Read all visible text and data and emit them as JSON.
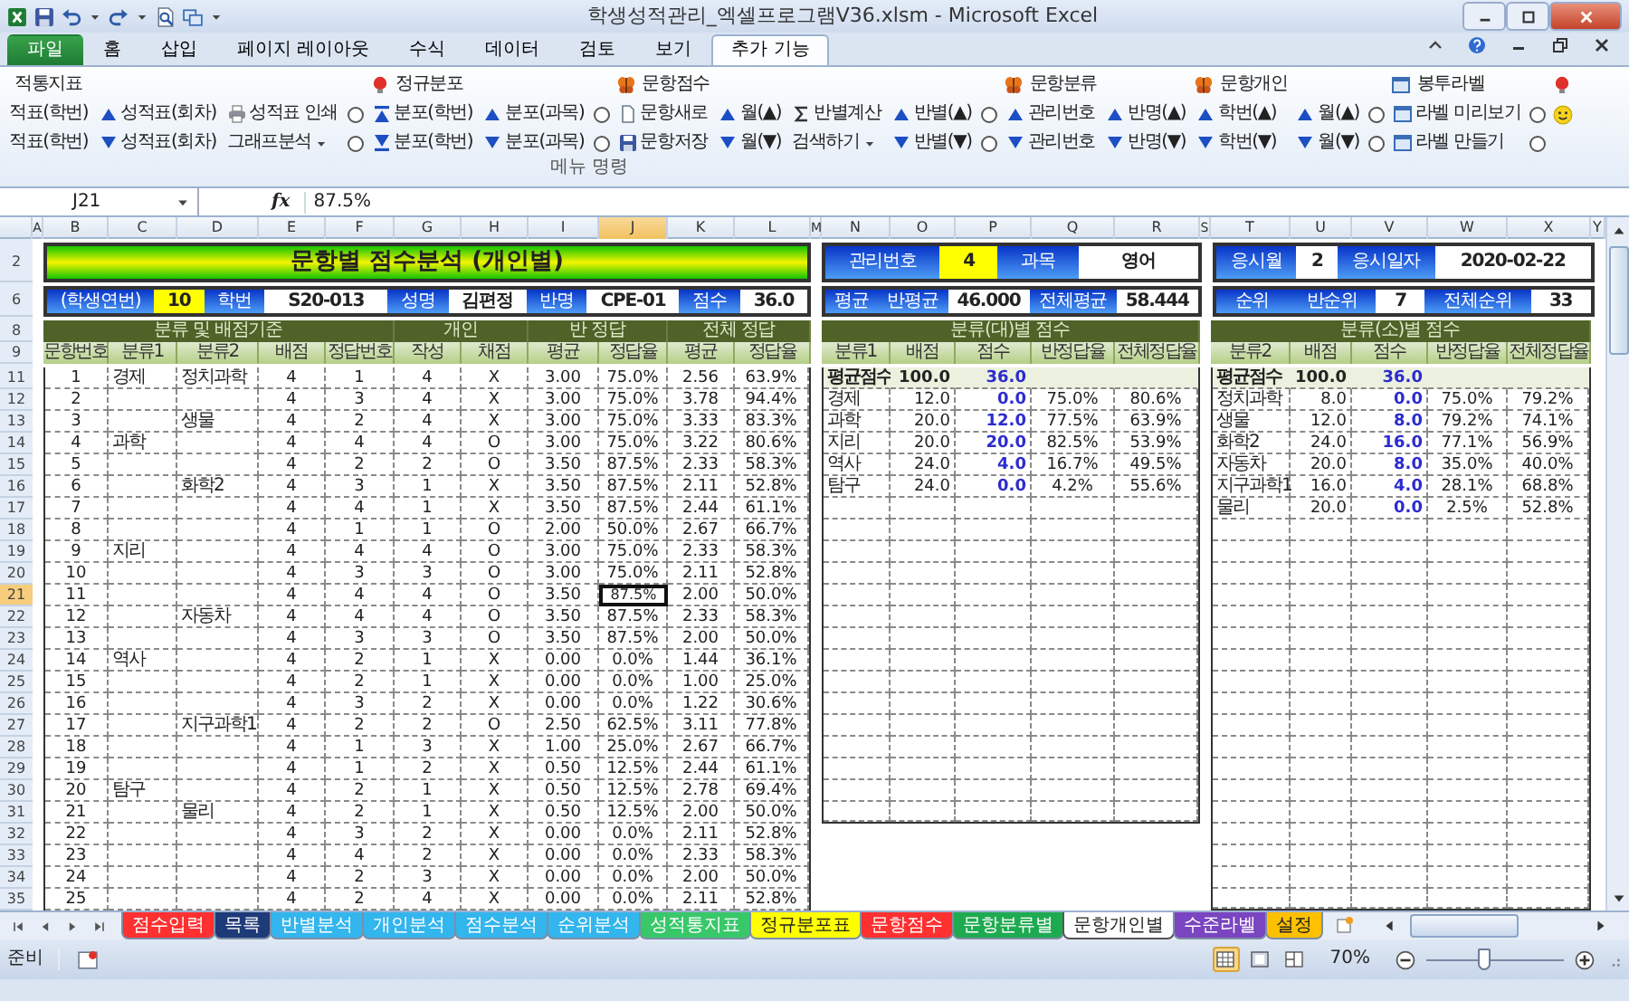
{
  "window": {
    "title": "학생성적관리_엑셀프로그램V36.xlsm  -  Microsoft Excel"
  },
  "ribbon_tabs": [
    {
      "label": "파일",
      "kind": "file",
      "selected": false
    },
    {
      "label": "홈",
      "kind": "tab",
      "selected": false
    },
    {
      "label": "삽입",
      "kind": "tab",
      "selected": false
    },
    {
      "label": "페이지 레이아웃",
      "kind": "tab",
      "selected": false
    },
    {
      "label": "수식",
      "kind": "tab",
      "selected": false
    },
    {
      "label": "데이터",
      "kind": "tab",
      "selected": false
    },
    {
      "label": "검토",
      "kind": "tab",
      "selected": false
    },
    {
      "label": "보기",
      "kind": "tab",
      "selected": false
    },
    {
      "label": "추가 기능",
      "kind": "tab",
      "selected": true
    }
  ],
  "ribbon": {
    "columns": [
      {
        "heading": {
          "kind": "heading",
          "label": "적통지표"
        },
        "items": [
          {
            "kind": "text",
            "label": "적표(학번)"
          },
          {
            "kind": "text",
            "label": "적표(학번)"
          }
        ]
      },
      {
        "items": [
          {
            "kind": "up",
            "label": "성적표(회차)"
          },
          {
            "kind": "down",
            "label": "성적표(회차)"
          }
        ]
      },
      {
        "items": [
          {
            "kind": "print",
            "label": "성적표 인쇄"
          },
          {
            "kind": "menu",
            "label": "그래프분석"
          }
        ]
      },
      {
        "items": [
          {
            "kind": "option",
            "checked": false
          },
          {
            "kind": "option",
            "checked": false
          }
        ]
      },
      {
        "heading": {
          "kind": "bulb",
          "label": "정규분포"
        },
        "items": [
          {
            "kind": "barup",
            "label": "분포(학번)"
          },
          {
            "kind": "bardown",
            "label": "분포(학번)"
          }
        ]
      },
      {
        "items": [
          {
            "kind": "up",
            "label": "분포(과목)"
          },
          {
            "kind": "down",
            "label": "분포(과목)"
          }
        ]
      },
      {
        "items": [
          {
            "kind": "option",
            "checked": false
          },
          {
            "kind": "option",
            "checked": false
          }
        ]
      },
      {
        "heading": {
          "kind": "bug",
          "label": "문항점수"
        },
        "items": [
          {
            "kind": "new",
            "label": "문항새로"
          },
          {
            "kind": "save",
            "label": "문항저장"
          }
        ]
      },
      {
        "items": [
          {
            "kind": "up",
            "label": "월(▲)"
          },
          {
            "kind": "down",
            "label": "월(▼)"
          }
        ]
      },
      {
        "items": [
          {
            "kind": "calc",
            "label": "반별계산"
          },
          {
            "kind": "menu",
            "label": "검색하기"
          }
        ]
      },
      {
        "items": [
          {
            "kind": "up",
            "label": "반별(▲)"
          },
          {
            "kind": "down",
            "label": "반별(▼)"
          }
        ]
      },
      {
        "items": [
          {
            "kind": "option",
            "checked": false
          },
          {
            "kind": "option",
            "checked": false
          }
        ]
      },
      {
        "heading": {
          "kind": "bug",
          "label": "문항분류"
        },
        "items": [
          {
            "kind": "up",
            "label": "관리번호"
          },
          {
            "kind": "down",
            "label": "관리번호"
          }
        ]
      },
      {
        "items": [
          {
            "kind": "up",
            "label": "반명(▲)"
          },
          {
            "kind": "down",
            "label": "반명(▼)"
          }
        ]
      },
      {
        "heading": {
          "kind": "bug",
          "label": "문항개인"
        },
        "items": [
          {
            "kind": "up",
            "label": "학번(▲)"
          },
          {
            "kind": "down",
            "label": "학번(▼)"
          }
        ]
      },
      {
        "items": [
          {
            "kind": "up",
            "label": "월(▲)"
          },
          {
            "kind": "down",
            "label": "월(▼)"
          }
        ]
      },
      {
        "items": [
          {
            "kind": "option",
            "checked": false
          },
          {
            "kind": "option",
            "checked": false
          }
        ]
      },
      {
        "heading": {
          "kind": "label",
          "label": "봉투라벨"
        },
        "items": [
          {
            "kind": "window",
            "label": "라벨 미리보기"
          },
          {
            "kind": "window",
            "label": "라벨 만들기"
          }
        ]
      },
      {
        "items": [
          {
            "kind": "option",
            "checked": false
          },
          {
            "kind": "option",
            "checked": false
          }
        ]
      },
      {
        "heading": {
          "kind": "bulb"
        },
        "items": [
          {
            "kind": "smiley"
          }
        ]
      }
    ],
    "group_label": "메뉴 명령"
  },
  "formula_bar": {
    "name_box": "J21",
    "function_label": "fx",
    "value": "87.5%"
  },
  "column_headers": [
    {
      "label": "A",
      "selected": false
    },
    {
      "label": "B",
      "selected": false
    },
    {
      "label": "C",
      "selected": false
    },
    {
      "label": "D",
      "selected": false
    },
    {
      "label": "E",
      "selected": false
    },
    {
      "label": "F",
      "selected": false
    },
    {
      "label": "G",
      "selected": false
    },
    {
      "label": "H",
      "selected": false
    },
    {
      "label": "I",
      "selected": false
    },
    {
      "label": "J",
      "selected": true
    },
    {
      "label": "K",
      "selected": false
    },
    {
      "label": "L",
      "selected": false
    },
    {
      "label": "M",
      "selected": false
    },
    {
      "label": "N",
      "selected": false
    },
    {
      "label": "O",
      "selected": false
    },
    {
      "label": "P",
      "selected": false
    },
    {
      "label": "Q",
      "selected": false
    },
    {
      "label": "R",
      "selected": false
    },
    {
      "label": "S",
      "selected": false
    },
    {
      "label": "T",
      "selected": false
    },
    {
      "label": "U",
      "selected": false
    },
    {
      "label": "V",
      "selected": false
    },
    {
      "label": "W",
      "selected": false
    },
    {
      "label": "X",
      "selected": false
    },
    {
      "label": "Y",
      "selected": false
    }
  ],
  "sheet": {
    "row_numbers": [
      {
        "label": "2",
        "selected": false
      },
      {
        "label": "6",
        "selected": false
      },
      {
        "label": "8",
        "selected": false
      },
      {
        "label": "9",
        "selected": false
      },
      {
        "label": "11",
        "selected": false
      },
      {
        "label": "12",
        "selected": false
      },
      {
        "label": "13",
        "selected": false
      },
      {
        "label": "14",
        "selected": false
      },
      {
        "label": "15",
        "selected": false
      },
      {
        "label": "16",
        "selected": false
      },
      {
        "label": "17",
        "selected": false
      },
      {
        "label": "18",
        "selected": false
      },
      {
        "label": "19",
        "selected": false
      },
      {
        "label": "20",
        "selected": false
      },
      {
        "label": "21",
        "selected": true
      },
      {
        "label": "22",
        "selected": false
      },
      {
        "label": "23",
        "selected": false
      },
      {
        "label": "24",
        "selected": false
      },
      {
        "label": "25",
        "selected": false
      },
      {
        "label": "26",
        "selected": false
      },
      {
        "label": "27",
        "selected": false
      },
      {
        "label": "28",
        "selected": false
      },
      {
        "label": "29",
        "selected": false
      },
      {
        "label": "30",
        "selected": false
      },
      {
        "label": "31",
        "selected": false
      },
      {
        "label": "32",
        "selected": false
      },
      {
        "label": "33",
        "selected": false
      },
      {
        "label": "34",
        "selected": false
      },
      {
        "label": "35",
        "selected": false
      }
    ],
    "title": "문항별 점수분석 (개인별)",
    "top_info": {
      "middle": [
        {
          "kind": "label",
          "text": "관리번호"
        },
        {
          "kind": "key",
          "text": "4"
        },
        {
          "kind": "label",
          "text": "과목"
        },
        {
          "kind": "wide",
          "text": "영어"
        }
      ],
      "right": [
        {
          "kind": "label",
          "text": "응시월"
        },
        {
          "kind": "value",
          "text": "2"
        },
        {
          "kind": "label",
          "text": "응시일자"
        },
        {
          "kind": "wide",
          "text": "2020-02-22"
        }
      ]
    },
    "info": {
      "left": [
        {
          "kind": "label",
          "text": "(학생연번)"
        },
        {
          "kind": "key",
          "text": "10"
        },
        {
          "kind": "label",
          "text": "학번"
        },
        {
          "kind": "wide",
          "text": "S20-013"
        },
        {
          "kind": "label",
          "text": "성명"
        },
        {
          "kind": "value",
          "text": "김편정"
        },
        {
          "kind": "label",
          "text": "반명"
        },
        {
          "kind": "value",
          "text": "CPE-01"
        },
        {
          "kind": "label",
          "text": "점수"
        },
        {
          "kind": "value",
          "text": "36.0"
        }
      ],
      "middle": [
        {
          "kind": "label",
          "text": "평균"
        },
        {
          "kind": "label",
          "text": "반평균"
        },
        {
          "kind": "value",
          "text": "46.000"
        },
        {
          "kind": "label",
          "text": "전체평균"
        },
        {
          "kind": "value",
          "text": "58.444"
        }
      ],
      "right": [
        {
          "kind": "label",
          "text": "순위"
        },
        {
          "kind": "label",
          "text": "반순위"
        },
        {
          "kind": "value",
          "text": "7"
        },
        {
          "kind": "label",
          "text": "전체순위"
        },
        {
          "kind": "value",
          "text": "33"
        }
      ]
    },
    "bands": {
      "left": [
        "분류 및 배점기준",
        "개인",
        "반 정답",
        "전체 정답"
      ],
      "middle": [
        "분류(대)별 점수"
      ],
      "right": [
        "분류(소)별 점수"
      ]
    },
    "headers": {
      "left": [
        "문항번호",
        "분류1",
        "분류2",
        "배점",
        "정답번호",
        "작성",
        "채점",
        "평균",
        "정답율",
        "평균",
        "정답율"
      ],
      "middle": [
        "분류1",
        "배점",
        "점수",
        "반정답율",
        "전체정답율"
      ],
      "right": [
        "분류2",
        "배점",
        "점수",
        "반정답율",
        "전체정답율"
      ]
    },
    "left_rows": [
      {
        "no": "1",
        "cat1": "경제",
        "cat2": "정치과학",
        "points": "4",
        "answer": "1",
        "written": "4",
        "mark": "X",
        "class_avg": "3.00",
        "class_rate": "75.0%",
        "all_avg": "2.56",
        "all_rate": "63.9%"
      },
      {
        "no": "2",
        "points": "4",
        "answer": "3",
        "written": "4",
        "mark": "X",
        "class_avg": "3.00",
        "class_rate": "75.0%",
        "all_avg": "3.78",
        "all_rate": "94.4%"
      },
      {
        "no": "3",
        "cat2": "생물",
        "points": "4",
        "answer": "2",
        "written": "4",
        "mark": "X",
        "class_avg": "3.00",
        "class_rate": "75.0%",
        "all_avg": "3.33",
        "all_rate": "83.3%"
      },
      {
        "no": "4",
        "cat1": "과학",
        "points": "4",
        "answer": "4",
        "written": "4",
        "mark": "O",
        "class_avg": "3.00",
        "class_rate": "75.0%",
        "all_avg": "3.22",
        "all_rate": "80.6%"
      },
      {
        "no": "5",
        "points": "4",
        "answer": "2",
        "written": "2",
        "mark": "O",
        "class_avg": "3.50",
        "class_rate": "87.5%",
        "all_avg": "2.33",
        "all_rate": "58.3%"
      },
      {
        "no": "6",
        "cat2": "화학2",
        "points": "4",
        "answer": "3",
        "written": "1",
        "mark": "X",
        "class_avg": "3.50",
        "class_rate": "87.5%",
        "all_avg": "2.11",
        "all_rate": "52.8%"
      },
      {
        "no": "7",
        "points": "4",
        "answer": "4",
        "written": "1",
        "mark": "X",
        "class_avg": "3.50",
        "class_rate": "87.5%",
        "all_avg": "2.44",
        "all_rate": "61.1%"
      },
      {
        "no": "8",
        "points": "4",
        "answer": "1",
        "written": "1",
        "mark": "O",
        "class_avg": "2.00",
        "class_rate": "50.0%",
        "all_avg": "2.67",
        "all_rate": "66.7%"
      },
      {
        "no": "9",
        "cat1": "지리",
        "points": "4",
        "answer": "4",
        "written": "4",
        "mark": "O",
        "class_avg": "3.00",
        "class_rate": "75.0%",
        "all_avg": "2.33",
        "all_rate": "58.3%"
      },
      {
        "no": "10",
        "points": "4",
        "answer": "3",
        "written": "3",
        "mark": "O",
        "class_avg": "3.00",
        "class_rate": "75.0%",
        "all_avg": "2.11",
        "all_rate": "52.8%"
      },
      {
        "no": "11",
        "points": "4",
        "answer": "4",
        "written": "4",
        "mark": "O",
        "class_avg": "3.50",
        "class_rate": "87.5%",
        "all_avg": "2.00",
        "all_rate": "50.0%"
      },
      {
        "no": "12",
        "cat2": "자동차",
        "points": "4",
        "answer": "4",
        "written": "4",
        "mark": "O",
        "class_avg": "3.50",
        "class_rate": "87.5%",
        "all_avg": "2.33",
        "all_rate": "58.3%"
      },
      {
        "no": "13",
        "points": "4",
        "answer": "3",
        "written": "3",
        "mark": "O",
        "class_avg": "3.50",
        "class_rate": "87.5%",
        "all_avg": "2.00",
        "all_rate": "50.0%"
      },
      {
        "no": "14",
        "cat1": "역사",
        "points": "4",
        "answer": "2",
        "written": "1",
        "mark": "X",
        "class_avg": "0.00",
        "class_rate": "0.0%",
        "all_avg": "1.44",
        "all_rate": "36.1%"
      },
      {
        "no": "15",
        "points": "4",
        "answer": "2",
        "written": "1",
        "mark": "X",
        "class_avg": "0.00",
        "class_rate": "0.0%",
        "all_avg": "1.00",
        "all_rate": "25.0%"
      },
      {
        "no": "16",
        "points": "4",
        "answer": "3",
        "written": "2",
        "mark": "X",
        "class_avg": "0.00",
        "class_rate": "0.0%",
        "all_avg": "1.22",
        "all_rate": "30.6%"
      },
      {
        "no": "17",
        "cat2": "지구과학1",
        "points": "4",
        "answer": "2",
        "written": "2",
        "mark": "O",
        "class_avg": "2.50",
        "class_rate": "62.5%",
        "all_avg": "3.11",
        "all_rate": "77.8%"
      },
      {
        "no": "18",
        "points": "4",
        "answer": "1",
        "written": "3",
        "mark": "X",
        "class_avg": "1.00",
        "class_rate": "25.0%",
        "all_avg": "2.67",
        "all_rate": "66.7%"
      },
      {
        "no": "19",
        "points": "4",
        "answer": "1",
        "written": "2",
        "mark": "X",
        "class_avg": "0.50",
        "class_rate": "12.5%",
        "all_avg": "2.44",
        "all_rate": "61.1%"
      },
      {
        "no": "20",
        "cat1": "탐구",
        "points": "4",
        "answer": "2",
        "written": "1",
        "mark": "X",
        "class_avg": "0.50",
        "class_rate": "12.5%",
        "all_avg": "2.78",
        "all_rate": "69.4%"
      },
      {
        "no": "21",
        "cat2": "물리",
        "points": "4",
        "answer": "2",
        "written": "1",
        "mark": "X",
        "class_avg": "0.50",
        "class_rate": "12.5%",
        "all_avg": "2.00",
        "all_rate": "50.0%"
      },
      {
        "no": "22",
        "points": "4",
        "answer": "3",
        "written": "2",
        "mark": "X",
        "class_avg": "0.00",
        "class_rate": "0.0%",
        "all_avg": "2.11",
        "all_rate": "52.8%"
      },
      {
        "no": "23",
        "points": "4",
        "answer": "4",
        "written": "2",
        "mark": "X",
        "class_avg": "0.00",
        "class_rate": "0.0%",
        "all_avg": "2.33",
        "all_rate": "58.3%"
      },
      {
        "no": "24",
        "points": "4",
        "answer": "2",
        "written": "3",
        "mark": "X",
        "class_avg": "0.00",
        "class_rate": "0.0%",
        "all_avg": "2.00",
        "all_rate": "50.0%"
      },
      {
        "no": "25",
        "points": "4",
        "answer": "2",
        "written": "4",
        "mark": "X",
        "class_avg": "0.00",
        "class_rate": "0.0%",
        "all_avg": "2.11",
        "all_rate": "52.8%"
      }
    ],
    "middle_summary": {
      "cat": "평균점수",
      "points": "100.0",
      "score": "36.0"
    },
    "middle_rows": [
      {
        "cat": "경제",
        "points": "12.0",
        "score": "0.0",
        "class_rate": "75.0%",
        "all_rate": "80.6%"
      },
      {
        "cat": "과학",
        "points": "20.0",
        "score": "12.0",
        "class_rate": "77.5%",
        "all_rate": "63.9%"
      },
      {
        "cat": "지리",
        "points": "20.0",
        "score": "20.0",
        "class_rate": "82.5%",
        "all_rate": "53.9%"
      },
      {
        "cat": "역사",
        "points": "24.0",
        "score": "4.0",
        "class_rate": "16.7%",
        "all_rate": "49.5%"
      },
      {
        "cat": "탐구",
        "points": "24.0",
        "score": "0.0",
        "class_rate": "4.2%",
        "all_rate": "55.6%"
      }
    ],
    "right_summary": {
      "cat": "평균점수",
      "points": "100.0",
      "score": "36.0"
    },
    "right_rows": [
      {
        "cat": "정치과학",
        "points": "8.0",
        "score": "0.0",
        "class_rate": "75.0%",
        "all_rate": "79.2%"
      },
      {
        "cat": "생물",
        "points": "12.0",
        "score": "8.0",
        "class_rate": "79.2%",
        "all_rate": "74.1%"
      },
      {
        "cat": "화학2",
        "points": "24.0",
        "score": "16.0",
        "class_rate": "77.1%",
        "all_rate": "56.9%"
      },
      {
        "cat": "자동차",
        "points": "20.0",
        "score": "8.0",
        "class_rate": "35.0%",
        "all_rate": "40.0%"
      },
      {
        "cat": "지구과학1",
        "points": "16.0",
        "score": "4.0",
        "class_rate": "28.1%",
        "all_rate": "68.8%"
      },
      {
        "cat": "물리",
        "points": "20.0",
        "score": "0.0",
        "class_rate": "2.5%",
        "all_rate": "52.8%"
      }
    ]
  },
  "sheet_tabs": [
    {
      "label": "점수입력",
      "color": "#ff3030",
      "selected": false
    },
    {
      "label": "목록",
      "color": "#1f3a78",
      "selected": false
    },
    {
      "label": "반별분석",
      "color": "#33b5ee",
      "selected": false
    },
    {
      "label": "개인분석",
      "color": "#33b5ee",
      "selected": false
    },
    {
      "label": "점수분석",
      "color": "#33b5ee",
      "selected": false
    },
    {
      "label": "순위분석",
      "color": "#33b5ee",
      "selected": false
    },
    {
      "label": "성적통지표",
      "color": "#38c86a",
      "selected": false
    },
    {
      "label": "정규분포표",
      "color": "#ffff00",
      "selected": false
    },
    {
      "label": "문항점수",
      "color": "#ff3030",
      "selected": false
    },
    {
      "label": "문항분류별",
      "color": "#1eaa50",
      "selected": false
    },
    {
      "label": "문항개인별",
      "color": "#ffffff",
      "selected": true
    },
    {
      "label": "수준라벨",
      "color": "#7a45c0",
      "selected": false
    },
    {
      "label": "설정",
      "color": "#ffc000",
      "selected": false
    }
  ],
  "status_bar": {
    "text": "준비",
    "views": [
      {
        "kind": "normal",
        "selected": true
      },
      {
        "kind": "layout",
        "selected": false
      },
      {
        "kind": "pagebreak",
        "selected": false
      }
    ],
    "zoom": "70%",
    "zoom_slider": {
      "level": 0.42
    }
  }
}
